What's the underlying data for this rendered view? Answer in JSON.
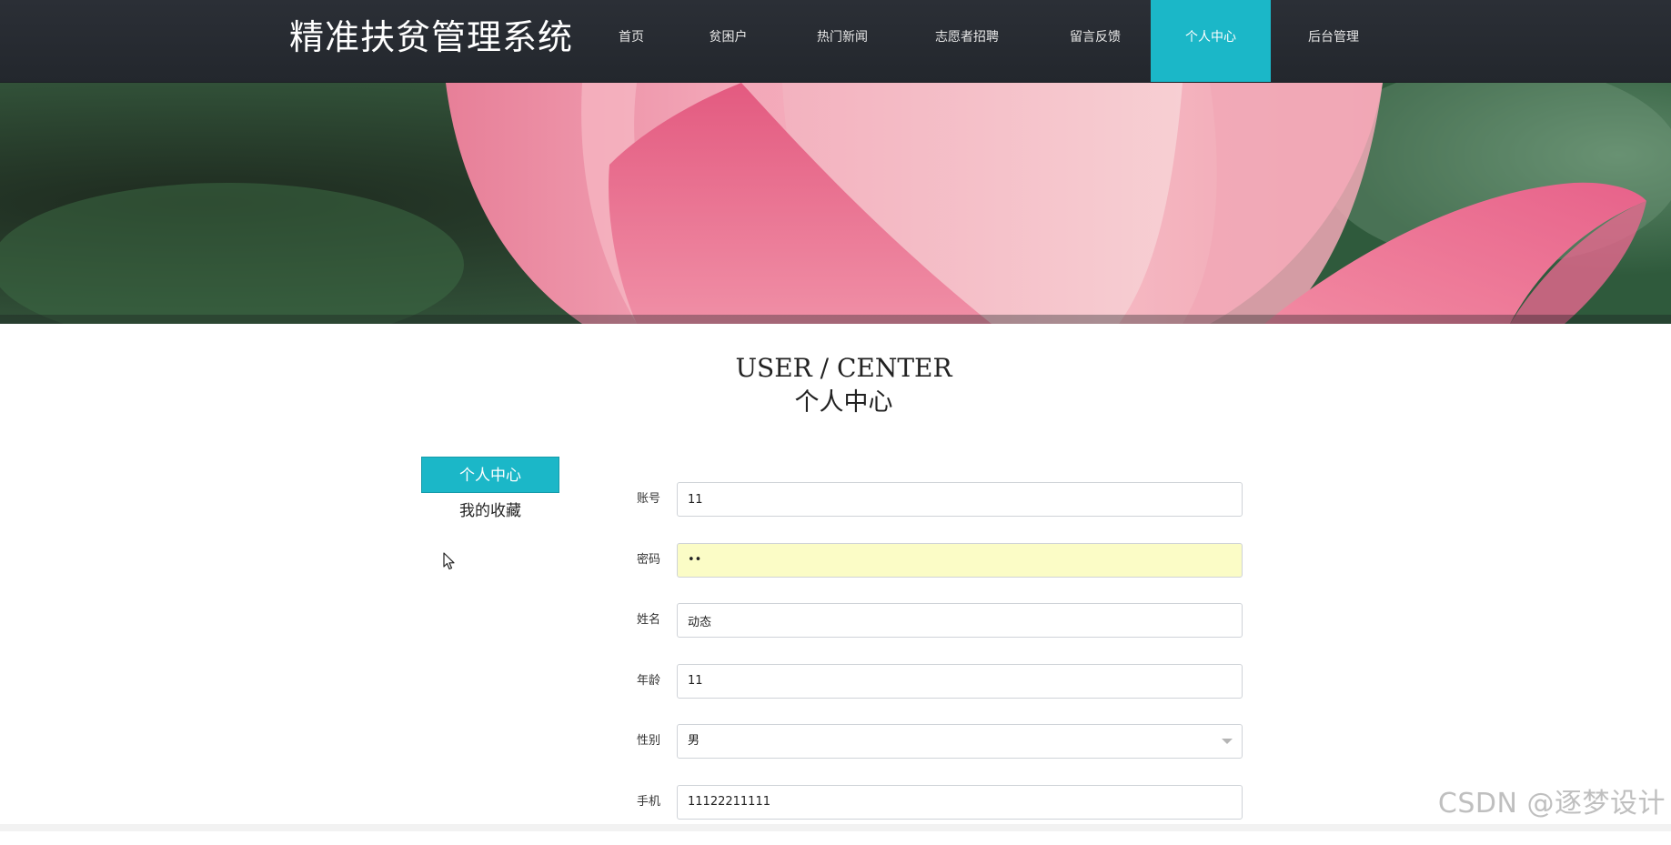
{
  "header": {
    "site_title": "精准扶贫管理系统",
    "nav": [
      {
        "label": "首页",
        "active": false
      },
      {
        "label": "贫困户",
        "active": false
      },
      {
        "label": "热门新闻",
        "active": false
      },
      {
        "label": "志愿者招聘",
        "active": false
      },
      {
        "label": "留言反馈",
        "active": false
      },
      {
        "label": "个人中心",
        "active": true
      },
      {
        "label": "后台管理",
        "active": false
      }
    ],
    "nav_bg_color": "#23272d",
    "accent_color": "#1bb7c8"
  },
  "page": {
    "heading_en": "USER / CENTER",
    "heading_cn": "个人中心"
  },
  "side_menu": {
    "items": [
      {
        "label": "个人中心",
        "active": true
      },
      {
        "label": "我的收藏",
        "active": false
      }
    ]
  },
  "form": {
    "fields": [
      {
        "label": "账号",
        "value": "11",
        "type": "text"
      },
      {
        "label": "密码",
        "value": "11",
        "type": "password"
      },
      {
        "label": "姓名",
        "value": "动态",
        "type": "text"
      },
      {
        "label": "年龄",
        "value": "11",
        "type": "text"
      },
      {
        "label": "性别",
        "value": "男",
        "type": "select"
      },
      {
        "label": "手机",
        "value": "11122211111",
        "type": "text"
      }
    ]
  },
  "watermark": "CSDN @逐梦设计"
}
